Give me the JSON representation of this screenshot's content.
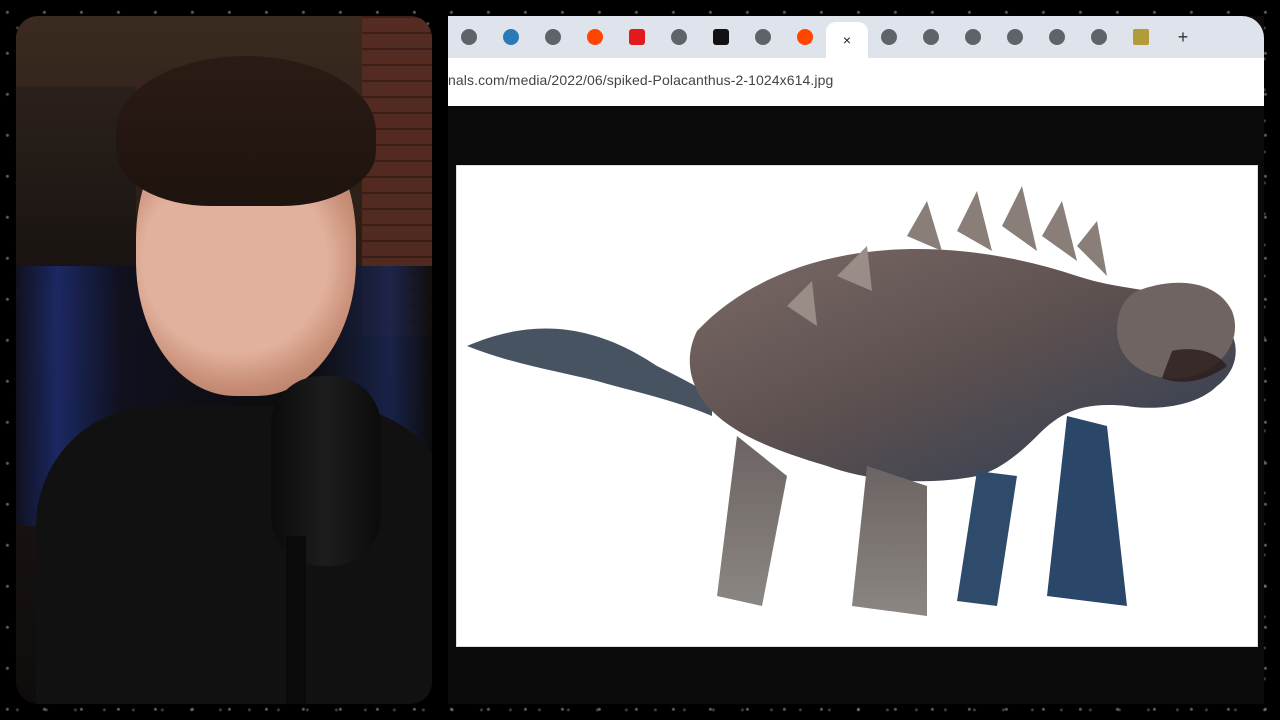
{
  "browser": {
    "tabs": [
      {
        "icon": "globe"
      },
      {
        "icon": "wikipedia"
      },
      {
        "icon": "globe"
      },
      {
        "icon": "reddit"
      },
      {
        "icon": "adobe"
      },
      {
        "icon": "globe"
      },
      {
        "icon": "x"
      },
      {
        "icon": "globe"
      },
      {
        "icon": "reddit"
      },
      {
        "icon": "close",
        "active": true
      },
      {
        "icon": "globe"
      },
      {
        "icon": "globe"
      },
      {
        "icon": "globe"
      },
      {
        "icon": "globe"
      },
      {
        "icon": "globe"
      },
      {
        "icon": "globe"
      },
      {
        "icon": "folder"
      }
    ],
    "new_tab_label": "+",
    "address": "nals.com/media/2022/06/spiked-Polacanthus-2-1024x614.jpg",
    "active_tab_close": "×"
  },
  "colors": {
    "tabbar": "#dfe3eb",
    "toolbar": "#ffffff",
    "viewport": "#0a0a0a"
  }
}
